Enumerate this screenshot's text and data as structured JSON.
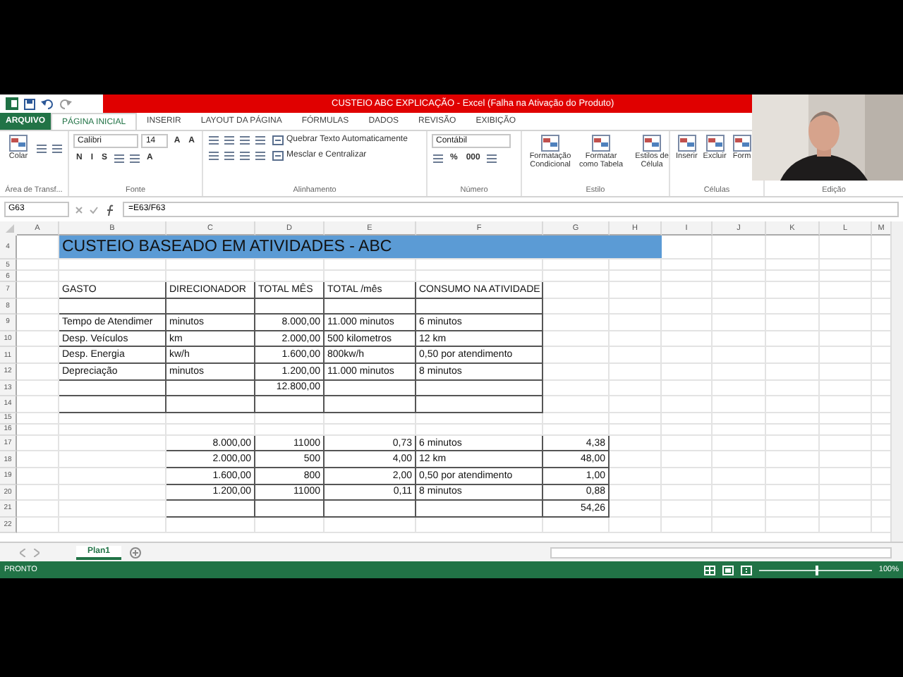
{
  "title_bar": {
    "title": "CUSTEIO ABC EXPLICAÇÃO - Excel (Falha na Ativação do Produto)"
  },
  "ribbon_tabs": [
    {
      "label": "ARQUIVO",
      "kind": "file",
      "selected": false
    },
    {
      "label": "PÁGINA INICIAL",
      "kind": "tab",
      "selected": true
    },
    {
      "label": "INSERIR",
      "kind": "tab",
      "selected": false
    },
    {
      "label": "LAYOUT DA PÁGINA",
      "kind": "tab",
      "selected": false
    },
    {
      "label": "FÓRMULAS",
      "kind": "tab",
      "selected": false
    },
    {
      "label": "DADOS",
      "kind": "tab",
      "selected": false
    },
    {
      "label": "REVISÃO",
      "kind": "tab",
      "selected": false
    },
    {
      "label": "EXIBIÇÃO",
      "kind": "tab",
      "selected": false
    }
  ],
  "ribbon_groups": [
    {
      "label": "Área de Transf...",
      "top": [
        {
          "kind": "big",
          "label": "Colar"
        },
        {
          "kind": "icon"
        },
        {
          "kind": "icon"
        }
      ]
    },
    {
      "label": "Fonte",
      "top": [
        {
          "kind": "field",
          "value": "Calibri"
        },
        {
          "kind": "small_field",
          "value": "14"
        },
        {
          "kind": "glyph",
          "text": "A"
        },
        {
          "kind": "glyph",
          "text": "A"
        }
      ],
      "bottom": [
        {
          "kind": "glyph",
          "text": "N"
        },
        {
          "kind": "glyph",
          "text": "I"
        },
        {
          "kind": "glyph",
          "text": "S"
        },
        {
          "kind": "icon"
        },
        {
          "kind": "icon"
        },
        {
          "kind": "glyph",
          "text": "A"
        }
      ]
    },
    {
      "label": "Alinhamento",
      "top": [
        {
          "kind": "icon"
        },
        {
          "kind": "icon"
        },
        {
          "kind": "icon"
        },
        {
          "kind": "icon"
        },
        {
          "kind": "text",
          "label": "Quebrar Texto Automaticamente"
        }
      ],
      "bottom": [
        {
          "kind": "icon"
        },
        {
          "kind": "icon"
        },
        {
          "kind": "icon"
        },
        {
          "kind": "icon"
        },
        {
          "kind": "text",
          "label": "Mesclar e Centralizar"
        }
      ]
    },
    {
      "label": "Número",
      "top": [
        {
          "kind": "field",
          "value": "Contábil"
        }
      ],
      "bottom": [
        {
          "kind": "icon"
        },
        {
          "kind": "glyph",
          "text": "%"
        },
        {
          "kind": "glyph",
          "text": "000"
        },
        {
          "kind": "icon"
        }
      ]
    },
    {
      "label": "Estilo",
      "top": [
        {
          "kind": "big",
          "label": "Formatação Condicional"
        },
        {
          "kind": "big",
          "label": "Formatar como Tabela"
        },
        {
          "kind": "big",
          "label": "Estilos de Célula"
        }
      ]
    },
    {
      "label": "Células",
      "top": [
        {
          "kind": "big",
          "label": "Inserir"
        },
        {
          "kind": "big",
          "label": "Excluir"
        },
        {
          "kind": "big",
          "label": "Form"
        }
      ]
    },
    {
      "label": "Edição"
    }
  ],
  "formula_bar": {
    "name_box": "G63",
    "formula": "=E63/F63"
  },
  "columns": [
    "A",
    "B",
    "C",
    "D",
    "E",
    "F",
    "G",
    "H",
    "I",
    "J",
    "K",
    "L",
    "M"
  ],
  "rows": [
    {
      "number": "4",
      "kind": "title",
      "cells": [
        {},
        {
          "text": "CUSTEIO BASEADO EM ATIVIDADES - ABC",
          "kind": "title"
        }
      ]
    },
    {
      "number": "5",
      "kind": "short",
      "cells": []
    },
    {
      "number": "6",
      "kind": "short",
      "cells": []
    },
    {
      "number": "7",
      "kind": "normal",
      "cells": [
        {},
        {
          "text": "GASTO",
          "boxed": true
        },
        {
          "text": "DIRECIONADOR",
          "boxed": true
        },
        {
          "text": "TOTAL MÊS",
          "boxed": true
        },
        {
          "text": "TOTAL /mês",
          "boxed": true
        },
        {
          "text": "CONSUMO NA ATIVIDADE",
          "boxed": true
        }
      ]
    },
    {
      "number": "8",
      "kind": "normal",
      "cells": [
        {},
        {
          "boxed": true
        },
        {
          "boxed": true
        },
        {
          "boxed": true
        },
        {
          "boxed": true
        },
        {
          "boxed": true
        }
      ]
    },
    {
      "number": "9",
      "kind": "normal",
      "cells": [
        {},
        {
          "text": "Tempo de Atendimer",
          "boxed": true
        },
        {
          "text": "minutos",
          "boxed": true
        },
        {
          "text": "8.000,00",
          "boxed": true,
          "kind": "number"
        },
        {
          "text": "11.000 minutos",
          "boxed": true
        },
        {
          "text": "6 minutos",
          "boxed": true
        }
      ]
    },
    {
      "number": "10",
      "kind": "normal",
      "cells": [
        {},
        {
          "text": "Desp. Veículos",
          "boxed": true
        },
        {
          "text": "km",
          "boxed": true
        },
        {
          "text": "2.000,00",
          "boxed": true,
          "kind": "number"
        },
        {
          "text": "500 kilometros",
          "boxed": true
        },
        {
          "text": "12 km",
          "boxed": true
        }
      ]
    },
    {
      "number": "11",
      "kind": "normal",
      "cells": [
        {},
        {
          "text": "Desp. Energia",
          "boxed": true
        },
        {
          "text": "kw/h",
          "boxed": true
        },
        {
          "text": "1.600,00",
          "boxed": true,
          "kind": "number"
        },
        {
          "text": "800kw/h",
          "boxed": true
        },
        {
          "text": "0,50 por atendimento",
          "boxed": true
        }
      ]
    },
    {
      "number": "12",
      "kind": "normal",
      "cells": [
        {},
        {
          "text": "Depreciação",
          "boxed": true
        },
        {
          "text": "minutos",
          "boxed": true
        },
        {
          "text": "1.200,00",
          "boxed": true,
          "kind": "number"
        },
        {
          "text": "11.000 minutos",
          "boxed": true
        },
        {
          "text": "8 minutos",
          "boxed": true
        }
      ]
    },
    {
      "number": "13",
      "kind": "normal",
      "cells": [
        {},
        {
          "boxed": true
        },
        {
          "boxed": true
        },
        {
          "text": "12.800,00",
          "boxed": true,
          "kind": "number"
        },
        {
          "boxed": true
        },
        {
          "boxed": true
        }
      ]
    },
    {
      "number": "14",
      "kind": "normal",
      "cells": [
        {},
        {
          "boxed": true
        },
        {
          "boxed": true
        },
        {
          "boxed": true
        },
        {
          "boxed": true
        },
        {
          "boxed": true
        }
      ]
    },
    {
      "number": "15",
      "kind": "short",
      "cells": []
    },
    {
      "number": "16",
      "kind": "short",
      "cells": []
    },
    {
      "number": "17",
      "kind": "normal",
      "cells": [
        {},
        {},
        {
          "text": "8.000,00",
          "boxed": true,
          "kind": "number"
        },
        {
          "text": "11000",
          "boxed": true,
          "kind": "number"
        },
        {
          "text": "0,73",
          "boxed": true,
          "kind": "number"
        },
        {
          "text": "6 minutos",
          "boxed": true
        },
        {
          "text": "4,38",
          "boxed": true,
          "kind": "number"
        }
      ]
    },
    {
      "number": "18",
      "kind": "normal",
      "cells": [
        {},
        {},
        {
          "text": "2.000,00",
          "boxed": true,
          "kind": "number"
        },
        {
          "text": "500",
          "boxed": true,
          "kind": "number"
        },
        {
          "text": "4,00",
          "boxed": true,
          "kind": "number"
        },
        {
          "text": "12 km",
          "boxed": true
        },
        {
          "text": "48,00",
          "boxed": true,
          "kind": "number"
        }
      ]
    },
    {
      "number": "19",
      "kind": "normal",
      "cells": [
        {},
        {},
        {
          "text": "1.600,00",
          "boxed": true,
          "kind": "number"
        },
        {
          "text": "800",
          "boxed": true,
          "kind": "number"
        },
        {
          "text": "2,00",
          "boxed": true,
          "kind": "number"
        },
        {
          "text": "0,50 por atendimento",
          "boxed": true
        },
        {
          "text": "1,00",
          "boxed": true,
          "kind": "number"
        }
      ]
    },
    {
      "number": "20",
      "kind": "normal",
      "cells": [
        {},
        {},
        {
          "text": "1.200,00",
          "boxed": true,
          "kind": "number"
        },
        {
          "text": "11000",
          "boxed": true,
          "kind": "number"
        },
        {
          "text": "0,11",
          "boxed": true,
          "kind": "number"
        },
        {
          "text": "8 minutos",
          "boxed": true
        },
        {
          "text": "0,88",
          "boxed": true,
          "kind": "number"
        }
      ]
    },
    {
      "number": "21",
      "kind": "normal",
      "cells": [
        {},
        {},
        {
          "boxed": true
        },
        {
          "boxed": true
        },
        {
          "boxed": true
        },
        {
          "boxed": true
        },
        {
          "text": "54,26",
          "boxed": true,
          "kind": "number"
        }
      ]
    },
    {
      "number": "22",
      "kind": "normal",
      "cells": []
    }
  ],
  "sheet_tabs": [
    {
      "label": "Plan1",
      "selected": true
    }
  ],
  "status_bar": {
    "status": "PRONTO",
    "zoom": "100%",
    "level": 0.5
  }
}
